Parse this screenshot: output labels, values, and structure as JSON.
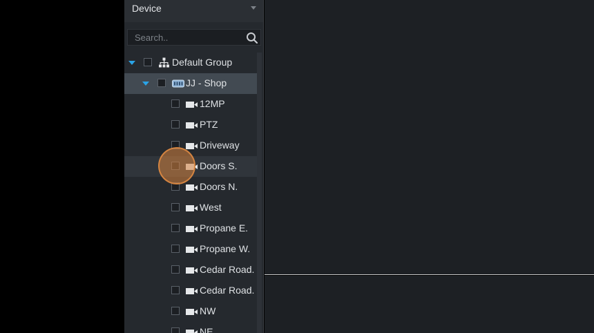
{
  "panel": {
    "title": "Device",
    "search_placeholder": "Search.."
  },
  "tree": {
    "group": {
      "label": "Default Group",
      "expanded": true
    },
    "site": {
      "label": "JJ - Shop",
      "expanded": true
    },
    "cameras": [
      {
        "label": "12MP"
      },
      {
        "label": "PTZ"
      },
      {
        "label": "Driveway"
      },
      {
        "label": "Doors S.",
        "hovered": true
      },
      {
        "label": "Doors N."
      },
      {
        "label": "West"
      },
      {
        "label": "Propane E."
      },
      {
        "label": "Propane W."
      },
      {
        "label": "Cedar Road."
      },
      {
        "label": "Cedar Road."
      },
      {
        "label": "NW"
      },
      {
        "label": "NE"
      }
    ]
  },
  "colors": {
    "accent": "#2aa3e6",
    "panel_bg": "#25292e",
    "selected_row": "#424a52",
    "click_indicator": "#d6823e"
  }
}
